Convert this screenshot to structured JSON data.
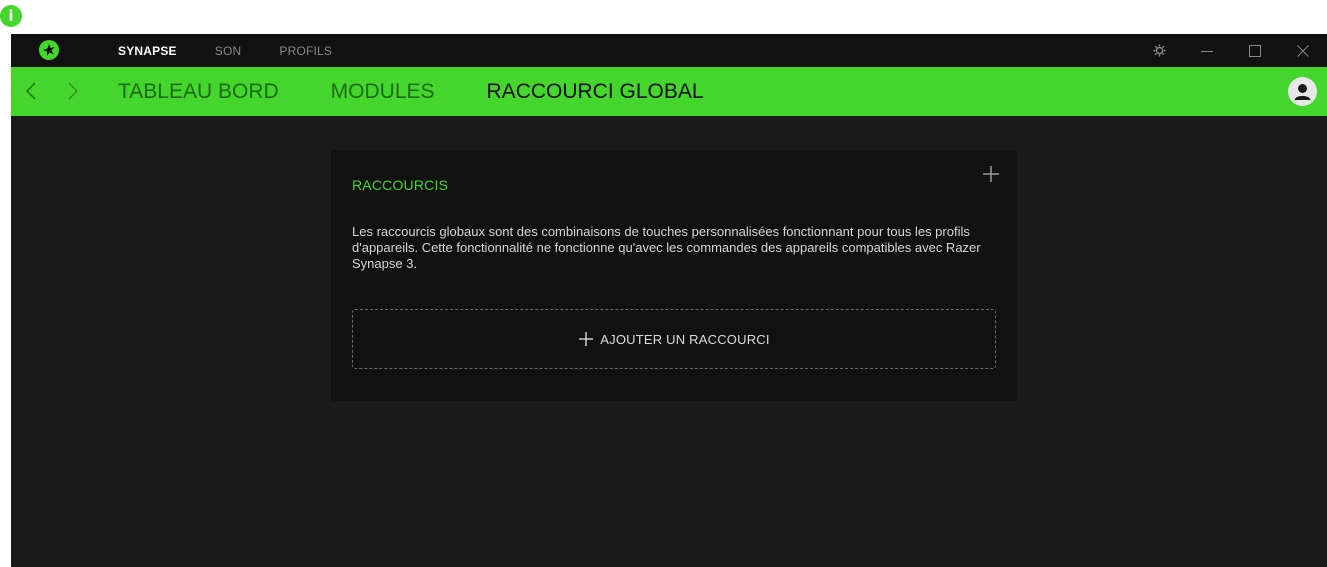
{
  "window": {
    "tabs": [
      {
        "label": "SYNAPSE",
        "active": true
      },
      {
        "label": "SON",
        "active": false
      },
      {
        "label": "PROFILS",
        "active": false
      }
    ],
    "controls": [
      "settings-icon",
      "minimize-icon",
      "maximize-icon",
      "close-icon"
    ]
  },
  "subnav": {
    "tabs": [
      {
        "label": "TABLEAU BORD",
        "active": false
      },
      {
        "label": "MODULES",
        "active": false
      },
      {
        "label": "RACCOURCI GLOBAL",
        "active": true
      }
    ]
  },
  "card": {
    "title": "RACCOURCIS",
    "description": "Les raccourcis globaux sont des combinaisons de touches personnalisées fonctionnant pour tous les profils d'appareils. Cette fonctionnalité ne fonctionne qu'avec les commandes des appareils compatibles avec Razer Synapse 3.",
    "add_button": "AJOUTER UN RACCOURCI"
  },
  "colors": {
    "accent": "#44d62c",
    "background": "#1a1a1a",
    "card": "#111111"
  }
}
